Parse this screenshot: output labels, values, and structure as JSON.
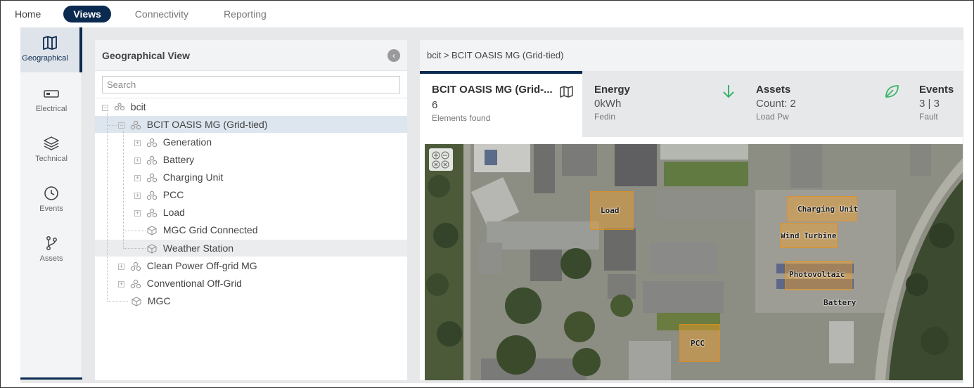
{
  "nav": {
    "tabs": [
      {
        "label": "Home"
      },
      {
        "label": "Views"
      },
      {
        "label": "Connectivity"
      },
      {
        "label": "Reporting"
      }
    ],
    "active_tab": "Views"
  },
  "rail": {
    "items": [
      {
        "label": "Geographical",
        "icon": "map-icon"
      },
      {
        "label": "Electrical",
        "icon": "battery-icon"
      },
      {
        "label": "Technical",
        "icon": "layers-icon"
      },
      {
        "label": "Events",
        "icon": "clock-icon"
      },
      {
        "label": "Assets",
        "icon": "branch-icon"
      }
    ]
  },
  "tree": {
    "title": "Geographical View",
    "search_placeholder": "Search",
    "nodes": {
      "root": "bcit",
      "site": "BCIT OASIS MG (Grid-tied)",
      "generation": "Generation",
      "battery": "Battery",
      "charging": "Charging Unit",
      "pcc": "PCC",
      "load": "Load",
      "mgc_grid": "MGC Grid Connected",
      "weather": "Weather Station",
      "clean_power": "Clean Power Off-grid MG",
      "conventional": "Conventional Off-Grid",
      "mgc": "MGC"
    }
  },
  "detail": {
    "breadcrumb": "bcit > BCIT OASIS MG (Grid-tied)",
    "card": {
      "name": "BCIT OASIS MG (Grid-...",
      "count": "6",
      "caption": "Elements found"
    },
    "stats": [
      {
        "title": "Energy",
        "value": "0kWh",
        "sub": "Fedin",
        "icon": "arrow-down-icon",
        "color": "#3bb36b"
      },
      {
        "title": "Assets",
        "value": "Count: 2",
        "sub": "Load Pw",
        "icon": "leaf-icon",
        "color": "#3bb36b"
      },
      {
        "title": "Events",
        "value": "3 | 3",
        "sub": "Fault"
      }
    ]
  },
  "map": {
    "labels": {
      "load": "Load",
      "charging": "Charging Unit",
      "wind": "Wind Turbine",
      "pv": "Photovoltaic",
      "battery": "Battery",
      "pcc": "PCC"
    }
  }
}
